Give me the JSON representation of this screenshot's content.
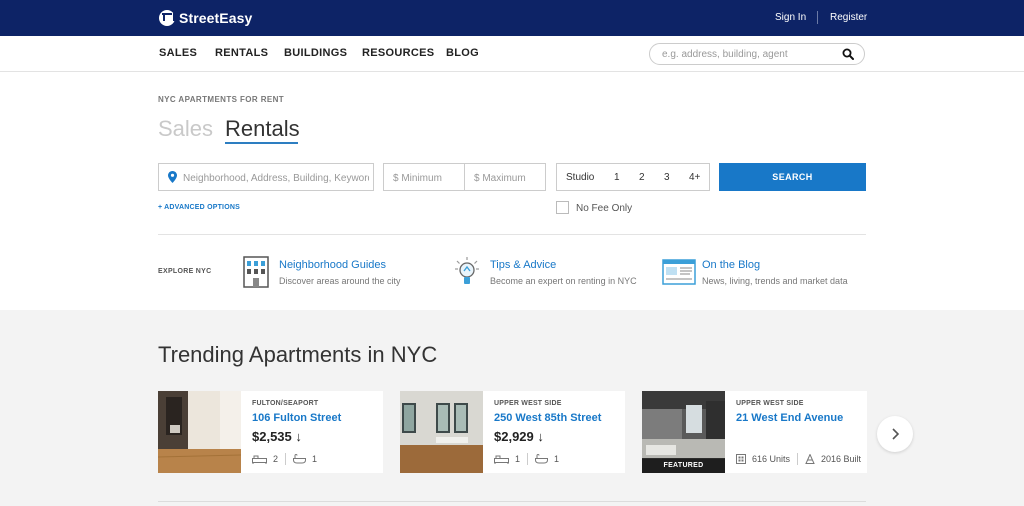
{
  "header": {
    "brand": "StreetEasy",
    "sign_in": "Sign In",
    "register": "Register",
    "nav": [
      "SALES",
      "RENTALS",
      "BUILDINGS",
      "RESOURCES",
      "BLOG"
    ],
    "search_placeholder": "e.g. address, building, agent"
  },
  "hero": {
    "kicker": "NYC APARTMENTS FOR RENT",
    "tab_sales": "Sales",
    "tab_rentals": "Rentals",
    "neighborhood_placeholder": "Neighborhood, Address, Building, Keyword",
    "min_placeholder": "$ Minimum",
    "max_placeholder": "$ Maximum",
    "beds": [
      "Studio",
      "1",
      "2",
      "3",
      "4+"
    ],
    "search_label": "SEARCH",
    "advanced": "+ ADVANCED OPTIONS",
    "no_fee": "No Fee Only"
  },
  "explore": {
    "label": "EXPLORE NYC",
    "items": [
      {
        "title": "Neighborhood Guides",
        "desc": "Discover areas around the city",
        "icon": "building-icon"
      },
      {
        "title": "Tips & Advice",
        "desc": "Become an expert on renting in NYC",
        "icon": "lightbulb-icon"
      },
      {
        "title": "On the Blog",
        "desc": "News, living, trends and market data",
        "icon": "browser-icon"
      }
    ]
  },
  "trending": {
    "title": "Trending Apartments in NYC",
    "cards": [
      {
        "hood": "FULTON/SEAPORT",
        "address": "106 Fulton Street",
        "price": "$2,535",
        "beds": "2",
        "baths": "1"
      },
      {
        "hood": "UPPER WEST SIDE",
        "address": "250 West 85th Street",
        "price": "$2,929",
        "beds": "1",
        "baths": "1"
      },
      {
        "hood": "UPPER WEST SIDE",
        "address": "21 West End Avenue",
        "units": "616 Units",
        "built": "2016 Built",
        "badge": "FEATURED"
      }
    ],
    "arrow": "›"
  },
  "colors": {
    "navy": "#0d2366",
    "accent": "#1878c8"
  }
}
